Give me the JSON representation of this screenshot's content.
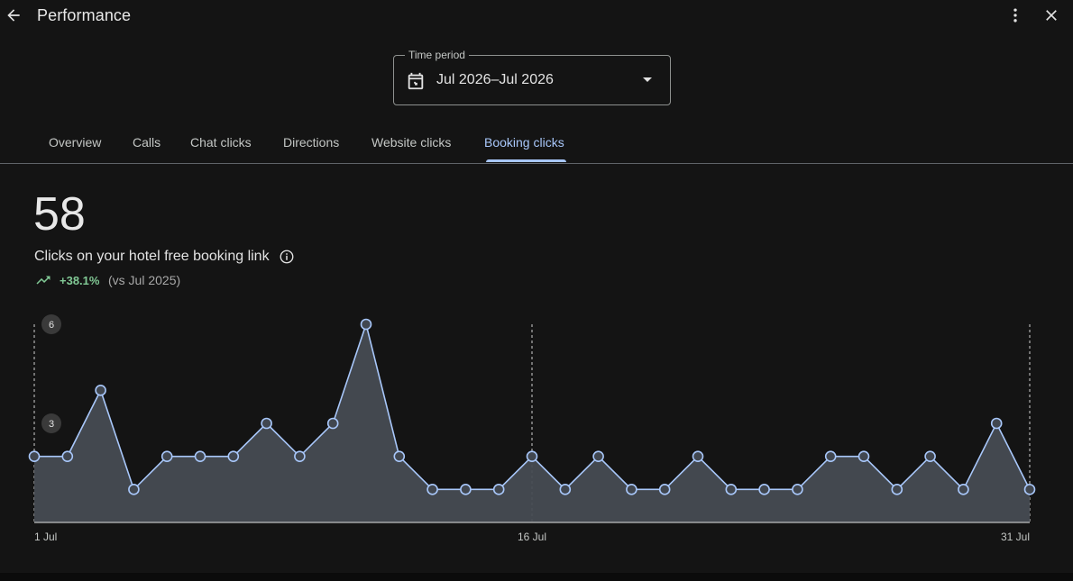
{
  "header": {
    "title": "Performance"
  },
  "time_period": {
    "label": "Time period",
    "value": "Jul 2026–Jul 2026"
  },
  "tabs": [
    {
      "label": "Overview",
      "active": false
    },
    {
      "label": "Calls",
      "active": false
    },
    {
      "label": "Chat clicks",
      "active": false
    },
    {
      "label": "Directions",
      "active": false
    },
    {
      "label": "Website clicks",
      "active": false
    },
    {
      "label": "Booking clicks",
      "active": true
    }
  ],
  "metric": {
    "total": "58",
    "label": "Clicks on your hotel free booking link",
    "change": "+38.1%",
    "comparison": "(vs Jul 2025)"
  },
  "colors": {
    "accent": "#a8c7fa",
    "positive": "#81c995",
    "line": "#a8c7fa",
    "area": "#464b52"
  },
  "icons": {
    "back": "arrow-left-icon",
    "more": "more-vert-icon",
    "close": "close-icon",
    "calendar": "calendar-icon",
    "info": "info-icon",
    "trend": "trending-up-icon"
  },
  "chart_data": {
    "type": "area",
    "x": [
      "1 Jul",
      "2 Jul",
      "3 Jul",
      "4 Jul",
      "5 Jul",
      "6 Jul",
      "7 Jul",
      "8 Jul",
      "9 Jul",
      "10 Jul",
      "11 Jul",
      "12 Jul",
      "13 Jul",
      "14 Jul",
      "15 Jul",
      "16 Jul",
      "17 Jul",
      "18 Jul",
      "19 Jul",
      "20 Jul",
      "21 Jul",
      "22 Jul",
      "23 Jul",
      "24 Jul",
      "25 Jul",
      "26 Jul",
      "27 Jul",
      "28 Jul",
      "29 Jul",
      "30 Jul",
      "31 Jul"
    ],
    "values": [
      2,
      2,
      4,
      1,
      2,
      2,
      2,
      3,
      2,
      3,
      6,
      2,
      1,
      1,
      1,
      2,
      1,
      2,
      1,
      1,
      2,
      1,
      1,
      1,
      2,
      2,
      1,
      2,
      1,
      3,
      1
    ],
    "ylim": [
      0,
      6
    ],
    "y_ticks": [
      "3",
      "6"
    ],
    "x_tick_labels": [
      "1 Jul",
      "16 Jul",
      "31 Jul"
    ]
  }
}
